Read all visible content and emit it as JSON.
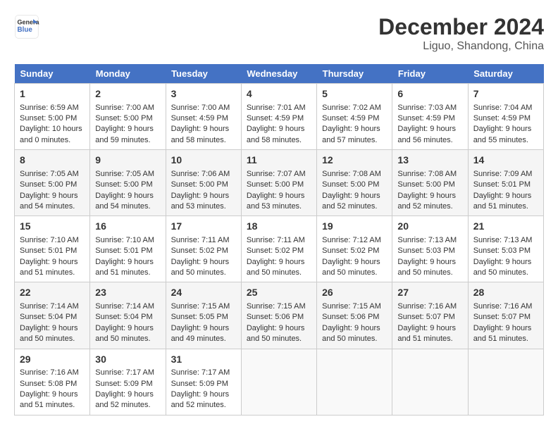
{
  "logo": {
    "line1": "General",
    "line2": "Blue"
  },
  "title": "December 2024",
  "subtitle": "Liguo, Shandong, China",
  "days_of_week": [
    "Sunday",
    "Monday",
    "Tuesday",
    "Wednesday",
    "Thursday",
    "Friday",
    "Saturday"
  ],
  "weeks": [
    [
      {
        "day": "1",
        "sunrise": "6:59 AM",
        "sunset": "5:00 PM",
        "daylight": "10 hours and 0 minutes."
      },
      {
        "day": "2",
        "sunrise": "7:00 AM",
        "sunset": "5:00 PM",
        "daylight": "9 hours and 59 minutes."
      },
      {
        "day": "3",
        "sunrise": "7:00 AM",
        "sunset": "4:59 PM",
        "daylight": "9 hours and 58 minutes."
      },
      {
        "day": "4",
        "sunrise": "7:01 AM",
        "sunset": "4:59 PM",
        "daylight": "9 hours and 58 minutes."
      },
      {
        "day": "5",
        "sunrise": "7:02 AM",
        "sunset": "4:59 PM",
        "daylight": "9 hours and 57 minutes."
      },
      {
        "day": "6",
        "sunrise": "7:03 AM",
        "sunset": "4:59 PM",
        "daylight": "9 hours and 56 minutes."
      },
      {
        "day": "7",
        "sunrise": "7:04 AM",
        "sunset": "4:59 PM",
        "daylight": "9 hours and 55 minutes."
      }
    ],
    [
      {
        "day": "8",
        "sunrise": "7:05 AM",
        "sunset": "5:00 PM",
        "daylight": "9 hours and 54 minutes."
      },
      {
        "day": "9",
        "sunrise": "7:05 AM",
        "sunset": "5:00 PM",
        "daylight": "9 hours and 54 minutes."
      },
      {
        "day": "10",
        "sunrise": "7:06 AM",
        "sunset": "5:00 PM",
        "daylight": "9 hours and 53 minutes."
      },
      {
        "day": "11",
        "sunrise": "7:07 AM",
        "sunset": "5:00 PM",
        "daylight": "9 hours and 53 minutes."
      },
      {
        "day": "12",
        "sunrise": "7:08 AM",
        "sunset": "5:00 PM",
        "daylight": "9 hours and 52 minutes."
      },
      {
        "day": "13",
        "sunrise": "7:08 AM",
        "sunset": "5:00 PM",
        "daylight": "9 hours and 52 minutes."
      },
      {
        "day": "14",
        "sunrise": "7:09 AM",
        "sunset": "5:01 PM",
        "daylight": "9 hours and 51 minutes."
      }
    ],
    [
      {
        "day": "15",
        "sunrise": "7:10 AM",
        "sunset": "5:01 PM",
        "daylight": "9 hours and 51 minutes."
      },
      {
        "day": "16",
        "sunrise": "7:10 AM",
        "sunset": "5:01 PM",
        "daylight": "9 hours and 51 minutes."
      },
      {
        "day": "17",
        "sunrise": "7:11 AM",
        "sunset": "5:02 PM",
        "daylight": "9 hours and 50 minutes."
      },
      {
        "day": "18",
        "sunrise": "7:11 AM",
        "sunset": "5:02 PM",
        "daylight": "9 hours and 50 minutes."
      },
      {
        "day": "19",
        "sunrise": "7:12 AM",
        "sunset": "5:02 PM",
        "daylight": "9 hours and 50 minutes."
      },
      {
        "day": "20",
        "sunrise": "7:13 AM",
        "sunset": "5:03 PM",
        "daylight": "9 hours and 50 minutes."
      },
      {
        "day": "21",
        "sunrise": "7:13 AM",
        "sunset": "5:03 PM",
        "daylight": "9 hours and 50 minutes."
      }
    ],
    [
      {
        "day": "22",
        "sunrise": "7:14 AM",
        "sunset": "5:04 PM",
        "daylight": "9 hours and 50 minutes."
      },
      {
        "day": "23",
        "sunrise": "7:14 AM",
        "sunset": "5:04 PM",
        "daylight": "9 hours and 50 minutes."
      },
      {
        "day": "24",
        "sunrise": "7:15 AM",
        "sunset": "5:05 PM",
        "daylight": "9 hours and 49 minutes."
      },
      {
        "day": "25",
        "sunrise": "7:15 AM",
        "sunset": "5:06 PM",
        "daylight": "9 hours and 50 minutes."
      },
      {
        "day": "26",
        "sunrise": "7:15 AM",
        "sunset": "5:06 PM",
        "daylight": "9 hours and 50 minutes."
      },
      {
        "day": "27",
        "sunrise": "7:16 AM",
        "sunset": "5:07 PM",
        "daylight": "9 hours and 51 minutes."
      },
      {
        "day": "28",
        "sunrise": "7:16 AM",
        "sunset": "5:07 PM",
        "daylight": "9 hours and 51 minutes."
      }
    ],
    [
      {
        "day": "29",
        "sunrise": "7:16 AM",
        "sunset": "5:08 PM",
        "daylight": "9 hours and 51 minutes."
      },
      {
        "day": "30",
        "sunrise": "7:17 AM",
        "sunset": "5:09 PM",
        "daylight": "9 hours and 52 minutes."
      },
      {
        "day": "31",
        "sunrise": "7:17 AM",
        "sunset": "5:09 PM",
        "daylight": "9 hours and 52 minutes."
      },
      null,
      null,
      null,
      null
    ]
  ]
}
